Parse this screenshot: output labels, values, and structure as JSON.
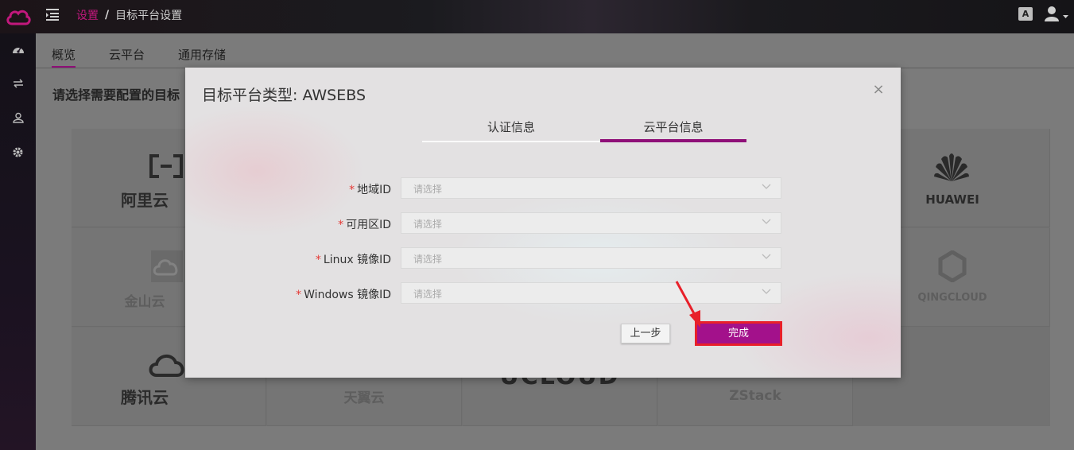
{
  "topbar": {
    "breadcrumb_link": "设置",
    "breadcrumb_sep": "/",
    "breadcrumb_current": "目标平台设置",
    "lang_icon_text": "A"
  },
  "tabs": [
    {
      "label": "概览",
      "active": true
    },
    {
      "label": "云平台",
      "active": false
    },
    {
      "label": "通用存储",
      "active": false
    }
  ],
  "section_title": "请选择需要配置的目标",
  "cards": [
    {
      "label": "阿里云"
    },
    {
      "label": "HUAWEI"
    },
    {
      "label": "金山云"
    },
    {
      "label": "QINGCLOUD"
    },
    {
      "label": "腾讯云"
    },
    {
      "label": "天翼云"
    },
    {
      "label": "UCLOUD"
    },
    {
      "label": "ZStack"
    }
  ],
  "modal": {
    "title": "目标平台类型: AWSEBS",
    "close_icon": "×",
    "steps": [
      {
        "label": "认证信息",
        "active": false
      },
      {
        "label": "云平台信息",
        "active": true
      }
    ],
    "fields": [
      {
        "label": "地域ID",
        "required_mark": "*",
        "placeholder": "请选择"
      },
      {
        "label": "可用区ID",
        "required_mark": "*",
        "placeholder": "请选择"
      },
      {
        "label": "Linux 镜像ID",
        "required_mark": "*",
        "placeholder": "请选择"
      },
      {
        "label": "Windows 镜像ID",
        "required_mark": "*",
        "placeholder": "请选择"
      }
    ],
    "prev_label": "上一步",
    "done_label": "完成"
  },
  "colors": {
    "accent": "#8f0f78",
    "done_button": "#a3118b",
    "highlight_border": "#e8202a"
  }
}
